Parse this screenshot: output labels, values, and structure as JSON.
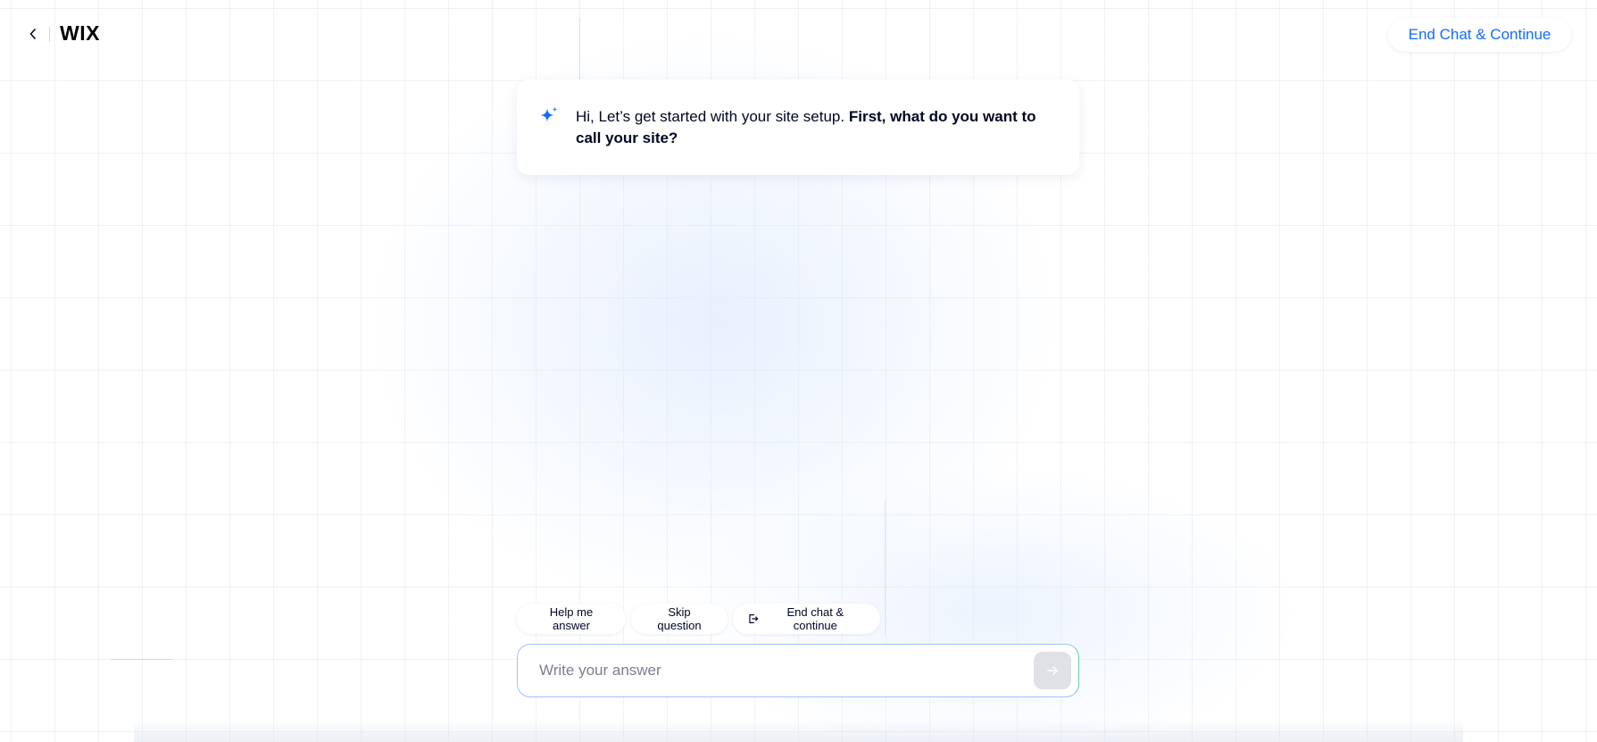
{
  "header": {
    "back_icon": "chevron-left-icon",
    "logo_text": "WIX",
    "end_chat_label": "End Chat & Continue"
  },
  "chat": {
    "assistant_icon": "sparkle-icon",
    "message_intro": "Hi, Let’s get started with your site setup. ",
    "message_question": "First, what do you want to call your site?"
  },
  "suggestions": {
    "help_label": "Help me answer",
    "skip_label": "Skip question",
    "end_label": "End chat & continue",
    "end_icon": "exit-icon"
  },
  "input": {
    "value": "",
    "placeholder": "Write your answer",
    "send_icon": "arrow-right-icon"
  },
  "colors": {
    "accent": "#116dff",
    "text": "#000624",
    "send_button_disabled": "#dfe1e6",
    "input_border_left": "#9fc2ff",
    "input_border_right": "#5fd3a8"
  }
}
